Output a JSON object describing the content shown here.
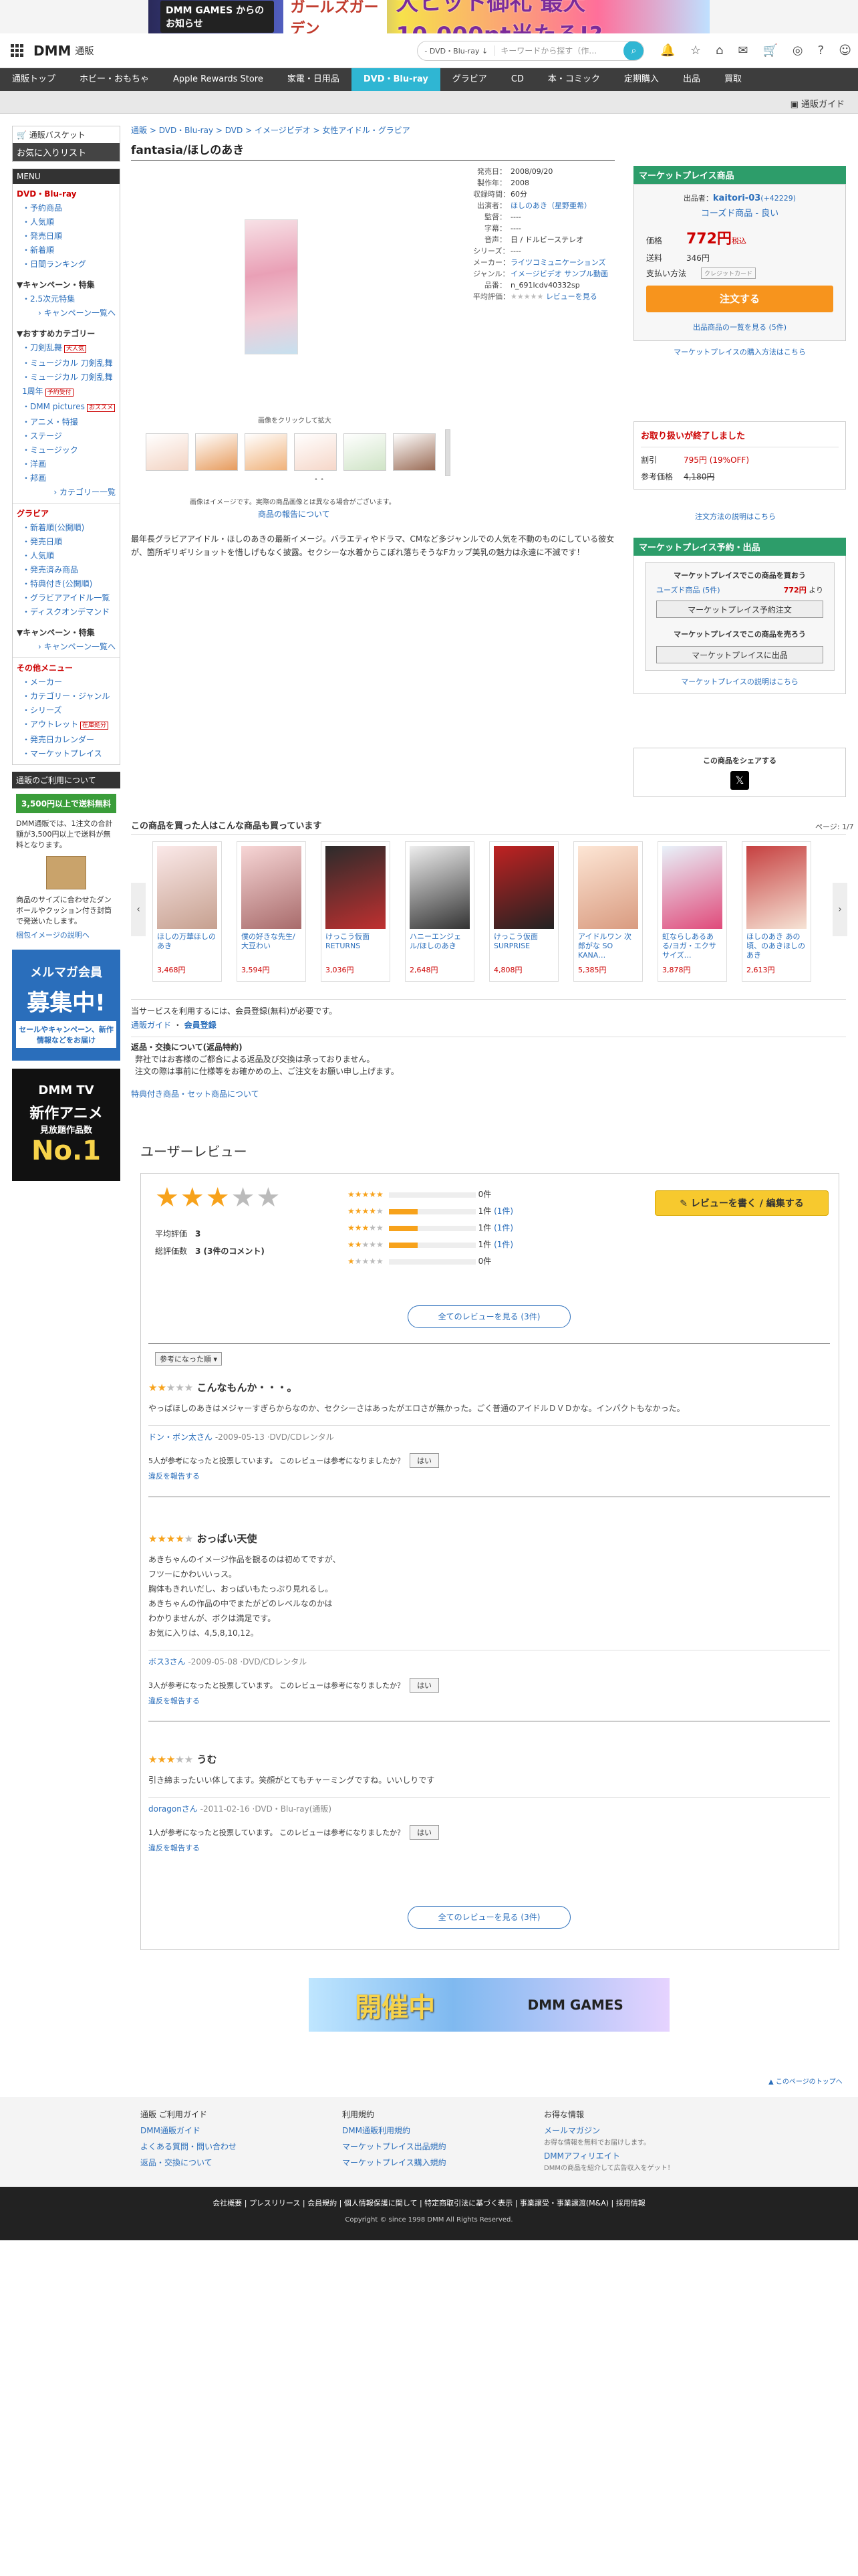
{
  "banner": {
    "label1": "DMM GAMES からのお知らせ",
    "label2": "ガールズガーデン",
    "label3": "大ヒット御礼 最大10,000pt当たる!?"
  },
  "header": {
    "logo": "DMM",
    "logo_sub": "通販",
    "search_category": "- DVD・Blu-ray ↓",
    "search_placeholder": "キーワードから探す（作…"
  },
  "nav": [
    "通販トップ",
    "ホビー・おもちゃ",
    "Apple Rewards Store",
    "家電・日用品",
    "DVD・Blu-ray",
    "グラビア",
    "CD",
    "本・コミック",
    "定期購入",
    "出品",
    "買取"
  ],
  "subnav": {
    "guide": "通販ガイド"
  },
  "sidebar": {
    "basket": "通販バスケット",
    "wishlist": "お気に入りリスト",
    "menu": "MENU",
    "dvd": {
      "title": "DVD・Blu-ray",
      "items": [
        "予約商品",
        "人気順",
        "発売日順",
        "新着順",
        "日間ランキング"
      ]
    },
    "campaign": {
      "title": "キャンペーン・特集",
      "item": "2.5次元特集",
      "more": "キャンペーン一覧へ"
    },
    "recommend": {
      "title": "おすすめカテゴリー",
      "items": [
        "刀剣乱舞",
        "ミュージカル 刀剣乱舞",
        "ミュージカル 刀剣乱舞 1周年",
        "DMM pictures",
        "アニメ・特撮",
        "ステージ",
        "ミュージック",
        "洋画",
        "邦画"
      ],
      "tags": [
        "大人気",
        "予約受付",
        "おススメ"
      ],
      "more": "カテゴリー一覧"
    },
    "gravure": {
      "title": "グラビア",
      "items": [
        "新着順(公開順)",
        "発売日順",
        "人気順",
        "発売済み商品",
        "特典付き(公開順)",
        "グラビアアイドル一覧",
        "ディスクオンデマンド"
      ]
    },
    "gcampaign": {
      "title": "キャンペーン・特集",
      "more": "キャンペーン一覧へ"
    },
    "other": {
      "title": "その他メニュー",
      "items": [
        "メーカー",
        "カテゴリー・ジャンル",
        "シリーズ",
        "アウトレット",
        "発売日カレンダー",
        "マーケットプレイス"
      ],
      "tag": "在庫処分"
    },
    "usage": {
      "title": "通販のご利用について",
      "free_title": "3,500円以上で送料無料",
      "free_text": "DMM通販では、1注文の合計額が3,500円以上で送料が無料となります。",
      "box_text": "商品のサイズに合わせたダンボールやクッション付き封筒で発送いたします。",
      "box_link": "梱包イメージの説明へ"
    },
    "mailmag": {
      "l1": "メルマガ会員",
      "l2": "募集中!",
      "l3": "セールやキャンペーン、新作情報などをお届け"
    },
    "dmmtv": {
      "l1": "DMM TV",
      "l2": "新作アニメ",
      "l3": "見放題作品数",
      "l4": "No.1"
    }
  },
  "breadcrumb": [
    "通販",
    "DVD・Blu-ray",
    "DVD",
    "イメージビデオ",
    "女性アイドル・グラビア"
  ],
  "product": {
    "title": "fantasia/ほしのあき",
    "click_hint": "画像をクリックして拡大",
    "thumb_note": "画像はイメージです。実際の商品画像とは異なる場合がございます。",
    "thumb_report": "商品の報告について",
    "description": "最年長グラビアアイドル・ほしのあきの最新イメージ。バラエティやドラマ、CMなど多ジャンルでの人気を不動のものにしている彼女が、箇所ギリギリショットを惜しげもなく披露。セクシーな水着からこぼれ落ちそうなFカップ美乳の魅力は永遠に不滅です！"
  },
  "info": [
    {
      "k": "発売日：",
      "v": "2008/09/20"
    },
    {
      "k": "製作年：",
      "v": "2008"
    },
    {
      "k": "収録時間：",
      "v": "60分"
    },
    {
      "k": "出演者：",
      "v": "ほしのあき（星野亜希）",
      "link": true
    },
    {
      "k": "監督：",
      "v": "----"
    },
    {
      "k": "字幕：",
      "v": "----"
    },
    {
      "k": "音声：",
      "v": "日 / ドルビーステレオ"
    },
    {
      "k": "シリーズ：",
      "v": "----"
    },
    {
      "k": "メーカー：",
      "v": "ライツコミュニケーションズ",
      "link": true
    },
    {
      "k": "ジャンル：",
      "v": "イメージビデオ サンプル動画",
      "link": true
    },
    {
      "k": "品番：",
      "v": "n_691lcdv40332sp"
    },
    {
      "k": "平均評価：",
      "v": "レビューを見る",
      "link": true
    }
  ],
  "marketplace": {
    "header": "マーケットプレイス商品",
    "seller_label": "出品者：",
    "seller": "kaitori-03",
    "seller_score": "(+42229)",
    "grade": "コーズド商品 - 良い",
    "price_label": "価格",
    "price": "772円",
    "price_tax": "税込",
    "ship_label": "送料",
    "ship": "346円",
    "pay_label": "支払い方法",
    "pay": "クレジットカード",
    "order": "注文する",
    "list_link": "出品商品の一覧を見る (5件)",
    "howto": "マーケットプレイスの購入方法はこちら"
  },
  "sold": {
    "title": "お取り扱いが終了しました",
    "l1": "割引",
    "v1": "795円 (19%OFF)",
    "l2": "参考価格",
    "v2": "4,180円",
    "link": "注文方法の説明はこちら"
  },
  "mp_reserve": {
    "header": "マーケットプレイス予約・出品",
    "buy_title": "マーケットプレイスでこの商品を買おう",
    "buy_sub": "ユーズド商品 (5件)",
    "buy_price": "772円",
    "buy_suffix": "より",
    "buy_btn": "マーケットプレイス予約注文",
    "sell_title": "マーケットプレイスでこの商品を売ろう",
    "sell_btn": "マーケットプレイスに出品",
    "desc": "マーケットプレイスの説明はこちら"
  },
  "share": {
    "title": "この商品をシェアする",
    "x": "𝕏"
  },
  "also": {
    "title": "この商品を買った人はこんな商品も買っています",
    "page": "ページ: 1/7",
    "items": [
      {
        "name": "ほしの万華ほしのあき",
        "price": "3,468円"
      },
      {
        "name": "僕の好きな先生/大豆わい",
        "price": "3,594円"
      },
      {
        "name": "けっこう仮面 RETURNS",
        "price": "3,036円"
      },
      {
        "name": "ハニーエンジェル/ほしのあき",
        "price": "2,648円"
      },
      {
        "name": "けっこう仮面 SURPRISE",
        "price": "4,808円"
      },
      {
        "name": "アイドルワン 次郎がな SO KANA…",
        "price": "5,385円"
      },
      {
        "name": "虹ならしあるある/ヨガ・エクササイズ…",
        "price": "3,878円"
      },
      {
        "name": "ほしのあき あの頃、のあきほしのあき",
        "price": "2,613円"
      }
    ]
  },
  "service": {
    "text": "当サービスを利用するには、会員登録(無料)が必要です。",
    "links": [
      "通販ガイド",
      "会員登録"
    ]
  },
  "returns": {
    "title": "返品・交換について(返品特約)",
    "l1": "弊社ではお客様のご都合による返品及び交換は承っておりません。",
    "l2": "注文の際は事前に仕様等をお確かめの上、ご注文をお願い申し上げます。",
    "link": "特典付き商品・セット商品について"
  },
  "reviews": {
    "title": "ユーザーレビュー",
    "avg_label": "平均評価",
    "avg": "3",
    "total_label": "総評価数",
    "total": "3 (3件のコメント)",
    "dist": [
      {
        "c": "0件",
        "l": ""
      },
      {
        "c": "1件",
        "l": "(1件)"
      },
      {
        "c": "1件",
        "l": "(1件)"
      },
      {
        "c": "1件",
        "l": "(1件)"
      },
      {
        "c": "0件",
        "l": ""
      }
    ],
    "write_btn": "レビューを書く / 編集する",
    "all_btn": "全てのレビューを見る (3件)",
    "sort": "参考になった順 ▾",
    "items": [
      {
        "stars": 2,
        "title": "こんなもんか・・・。",
        "body": [
          "やっぱほしのあきはメジャーすぎらからなのか、セクシーさはあったがエロさが無かった。ごく普通のアイドルＤＶＤかな。インパクトもなかった。"
        ],
        "author": "ドン・ボン太さん",
        "meta": "2009-05-13 ·DVD/CDレンタル",
        "helpful": "5人が参考になったと投票しています。 このレビューは参考になりましたか？",
        "yes": "はい",
        "report": "違反を報告する"
      },
      {
        "stars": 4,
        "title": "おっぱい天使",
        "body": [
          "あきちゃんのイメージ作品を観るのは初めてですが、",
          "フツーにかわいいっス。",
          "胸体もきれいだし、おっぱいもたっぷり見れるし。",
          "あきちゃんの作品の中でまたがどのレベルなのかは",
          "わかりませんが、ボクは満足です。",
          "お気に入りは、4,5,8,10,12。"
        ],
        "author": "ボス3さん",
        "meta": "2009-05-08 ·DVD/CDレンタル",
        "helpful": "3人が参考になったと投票しています。 このレビューは参考になりましたか？",
        "yes": "はい",
        "report": "違反を報告する"
      },
      {
        "stars": 3,
        "title": "うむ",
        "body": [
          "引き締まったいい体してます。笑顔がとてもチャーミングですね。いいしりです"
        ],
        "author": "doragonさん",
        "meta": "2011-02-16 ·DVD・Blu-ray(通販)",
        "helpful": "1人が参考になったと投票しています。 このレビューは参考になりましたか？",
        "yes": "はい",
        "report": "違反を報告する"
      }
    ]
  },
  "bottom_banner": {
    "l1": "開催中",
    "l2": "DMM GAMES"
  },
  "pagetop": "このページのトップへ",
  "footer": {
    "cols": [
      {
        "hd": "通販 ご利用ガイド",
        "links": [
          "DMM通販ガイド",
          "よくある質問・問い合わせ",
          "返品・交換について"
        ]
      },
      {
        "hd": "利用規約",
        "links": [
          "DMM通販利用規約",
          "マーケットプレイス出品規約",
          "マーケットプレイス購入規約"
        ]
      },
      {
        "hd": "お得な情報",
        "links": [
          "メールマガジン",
          "DMMアフィリエイト"
        ],
        "subs": [
          "お得な情報を無料でお届けします。",
          "DMMの商品を紹介して広告収入をゲット！"
        ]
      }
    ],
    "links": [
      "会社概要",
      "プレスリリース",
      "会員規約",
      "個人情報保護に関して",
      "特定商取引法に基づく表示",
      "事業譲受・事業譲渡(M&A)",
      "採用情報"
    ],
    "copyright": "Copyright © since 1998 DMM All Rights Reserved."
  },
  "colors": {
    "accent": "#2fb6d3",
    "green": "#2d9d6a",
    "orange": "#f7941d",
    "price": "#c00000"
  }
}
